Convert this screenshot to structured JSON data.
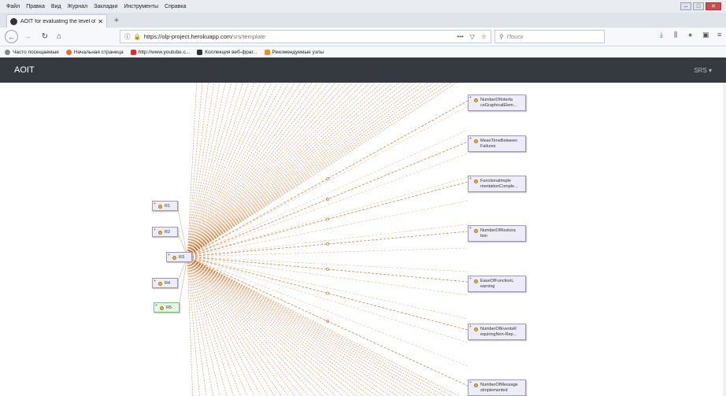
{
  "browser": {
    "menu": [
      "Файл",
      "Правка",
      "Вид",
      "Журнал",
      "Закладки",
      "Инструменты",
      "Справка"
    ],
    "tab_title": "AOIT for evaluating the level of",
    "url_host": "https://olp-project.herokuapp.com",
    "url_path": "/srs/template",
    "search_placeholder": "Поиск",
    "bookmarks": [
      {
        "label": "Часто посещаемые",
        "color": "#888888"
      },
      {
        "label": "Начальная страница",
        "color": "#e0702a"
      },
      {
        "label": "http://www.youtube.c...",
        "color": "#e52d27"
      },
      {
        "label": "Коллекция веб-фраг...",
        "color": "#333333"
      },
      {
        "label": "Рекомендуемые узлы",
        "color": "#f28a1e"
      }
    ]
  },
  "app": {
    "brand": "AOIT",
    "menu_label": "SRS ▾"
  },
  "graph": {
    "edge_color": "#d2691e",
    "left_nodes": [
      "R1",
      "R2",
      "R3",
      "R4",
      "R5"
    ],
    "selected_left": "R5",
    "right_nodes": [
      "NumberOfInterfaceGraphicalElem...",
      "MeanTimeBetweenFailures",
      "FunctionalImplementationComple...",
      "NumberOfRestoration",
      "EaseOfFunctionLearning",
      "NumberOfEventsRequiringNon-Rep...",
      "NumberOfMessagesImplemented"
    ],
    "right_node_lines": [
      [
        "NumberOfInterfa",
        "ceGraphicalElem..."
      ],
      [
        "MeanTimeBetween",
        "Failures"
      ],
      [
        "FunctionalImple",
        "mentationComple..."
      ],
      [
        "NumberOfRestora",
        "tion"
      ],
      [
        "EaseOfFunctionL",
        "earning"
      ],
      [
        "NumberOfEventsR",
        "equiringNon-Rep..."
      ],
      [
        "NumberOfMessage",
        "sImplemented"
      ]
    ]
  }
}
